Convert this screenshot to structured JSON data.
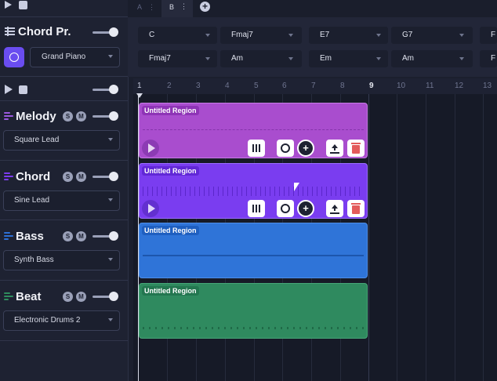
{
  "tabs": [
    {
      "label": "A"
    },
    {
      "label": "B"
    }
  ],
  "chord_progression": {
    "title": "Chord Pr.",
    "instrument": "Grand Piano",
    "chords": [
      "C",
      "Fmaj7",
      "E7",
      "G7",
      "Fmaj7",
      "Am",
      "Em",
      "Am"
    ],
    "cut_off_chords": [
      "F",
      "F"
    ]
  },
  "ruler": [
    "1",
    "2",
    "3",
    "4",
    "5",
    "6",
    "7",
    "8",
    "9",
    "10",
    "11",
    "12",
    "13"
  ],
  "tracks": [
    {
      "name": "Melody",
      "instrument": "Square Lead",
      "color": "#9b59e0",
      "solo": "S",
      "mute": "M"
    },
    {
      "name": "Chord",
      "instrument": "Sine Lead",
      "color": "#7d3cf2",
      "solo": "S",
      "mute": "M"
    },
    {
      "name": "Bass",
      "instrument": "Synth Bass",
      "color": "#2d6fd6",
      "solo": "S",
      "mute": "M"
    },
    {
      "name": "Beat",
      "instrument": "Electronic Drums 2",
      "color": "#2f8c5e",
      "solo": "S",
      "mute": "M"
    }
  ],
  "regions": [
    {
      "label": "Untitled Region",
      "color": "#a94dce"
    },
    {
      "label": "Untitled Region",
      "color": "#7a3df0"
    },
    {
      "label": "Untitled Region",
      "color": "#2f74d8"
    },
    {
      "label": "Untitled Region",
      "color": "#2f8a5f"
    }
  ],
  "colors": {
    "accent_ai": "#6a4df0",
    "delete_red": "#e35b5b",
    "background": "#1b1f2e"
  }
}
